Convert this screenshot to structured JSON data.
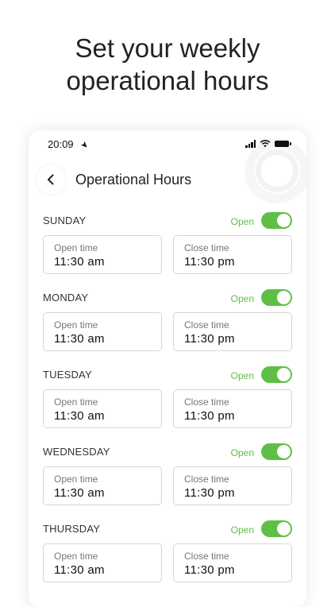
{
  "headline": {
    "line1": "Set your weekly",
    "line2": "operational hours"
  },
  "status_bar": {
    "time": "20:09",
    "location_icon": "location-arrow-icon",
    "signal_icon": "signal-icon",
    "wifi_icon": "wifi-icon",
    "battery_icon": "battery-icon"
  },
  "header": {
    "back_icon": "chevron-left-icon",
    "title": "Operational Hours"
  },
  "colors": {
    "accent_green": "#5fbf45",
    "text_dark": "#222222",
    "border": "#d6d6d6"
  },
  "days": [
    {
      "name": "SUNDAY",
      "status": "Open",
      "enabled": true,
      "open_label": "Open time",
      "open_value": "11:30 am",
      "close_label": "Close time",
      "close_value": "11:30 pm"
    },
    {
      "name": "MONDAY",
      "status": "Open",
      "enabled": true,
      "open_label": "Open time",
      "open_value": "11:30 am",
      "close_label": "Close time",
      "close_value": "11:30 pm"
    },
    {
      "name": "TUESDAY",
      "status": "Open",
      "enabled": true,
      "open_label": "Open time",
      "open_value": "11:30 am",
      "close_label": "Close time",
      "close_value": "11:30 pm"
    },
    {
      "name": "WEDNESDAY",
      "status": "Open",
      "enabled": true,
      "open_label": "Open time",
      "open_value": "11:30 am",
      "close_label": "Close time",
      "close_value": "11:30 pm"
    },
    {
      "name": "THURSDAY",
      "status": "Open",
      "enabled": true,
      "open_label": "Open time",
      "open_value": "11:30 am",
      "close_label": "Close time",
      "close_value": "11:30 pm"
    }
  ]
}
